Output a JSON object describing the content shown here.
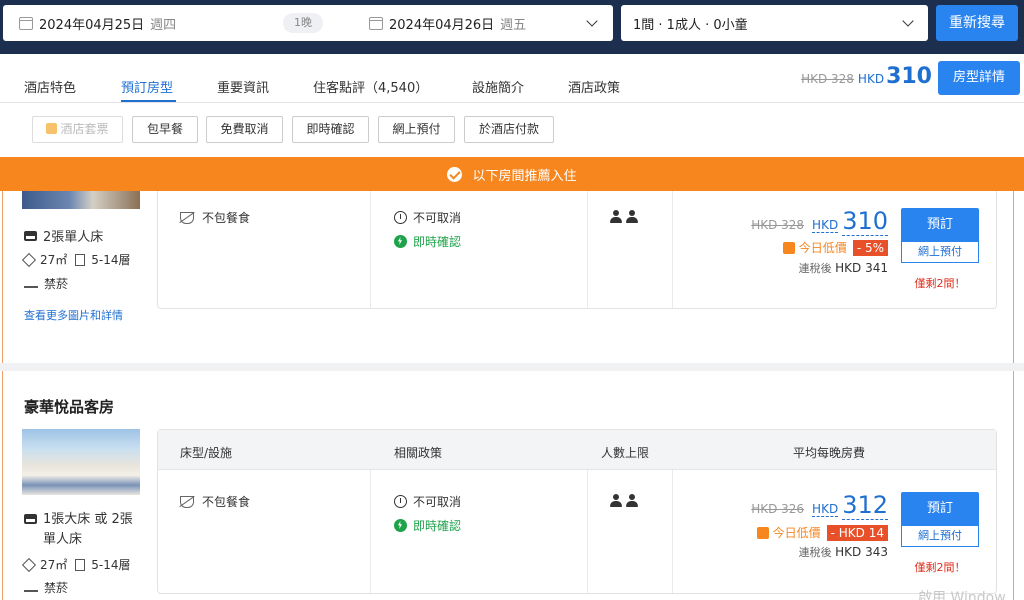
{
  "search": {
    "checkin_date": "2024年04月25日",
    "checkin_weekday": "週四",
    "nights": "1晚",
    "checkout_date": "2024年04月26日",
    "checkout_weekday": "週五",
    "guests": "1間 · 1成人 · 0小童",
    "search_button": "重新搜尋"
  },
  "tabs": [
    {
      "label": "酒店特色"
    },
    {
      "label": "預訂房型",
      "active": true
    },
    {
      "label": "重要資訊"
    },
    {
      "label": "住客點評（4,540）"
    },
    {
      "label": "設施簡介"
    },
    {
      "label": "酒店政策"
    }
  ],
  "header_price": {
    "original": "HKD 328",
    "currency": "HKD",
    "price": "310",
    "details_button": "房型詳情"
  },
  "filters": [
    "酒店套票",
    "包早餐",
    "免費取消",
    "即時確認",
    "網上預付",
    "於酒店付款"
  ],
  "banner": "以下房間推薦入住",
  "rooms": [
    {
      "bed": "2張單人床",
      "area": "27㎡",
      "floor": "5-14層",
      "smoking": "禁菸",
      "more_link": "查看更多圖片和詳情",
      "meal": "不包餐食",
      "cancel": "不可取消",
      "confirm": "即時確認",
      "original_price": "HKD 328",
      "currency": "HKD",
      "price": "310",
      "low_label": "今日低價",
      "discount": "- 5%",
      "tax": "連稅後",
      "tax_price": "HKD 341",
      "book": "預訂",
      "prepay": "網上預付",
      "remaining": "僅剩2間！"
    },
    {
      "title": "豪華悅品客房",
      "bed": "1張大床 或 2張單人床",
      "area": "27㎡",
      "floor": "5-14層",
      "smoking": "禁菸",
      "meal": "不包餐食",
      "cancel": "不可取消",
      "confirm": "即時確認",
      "original_price": "HKD 326",
      "currency": "HKD",
      "price": "312",
      "low_label": "今日低價",
      "discount": "- HKD 14",
      "tax": "連稅後",
      "tax_price": "HKD 343",
      "book": "預訂",
      "prepay": "網上預付",
      "remaining": "僅剩2間！"
    }
  ],
  "table_headers": [
    "床型/設施",
    "相關政策",
    "人數上限",
    "平均每晚房費"
  ],
  "watermark": "啟用 Window"
}
